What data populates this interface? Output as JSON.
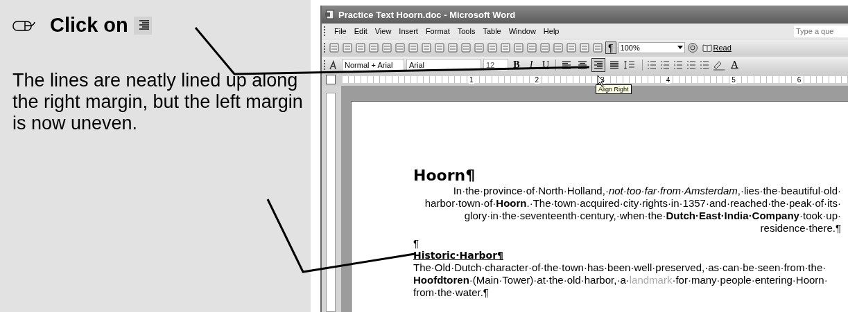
{
  "instructions": {
    "step": "Click on",
    "explanation": "The lines are neatly lined up along the right margin, but the left margin is now uneven."
  },
  "window": {
    "title": "Practice Text Hoorn.doc - Microsoft Word"
  },
  "menu": [
    "File",
    "Edit",
    "View",
    "Insert",
    "Format",
    "Tools",
    "Table",
    "Window",
    "Help"
  ],
  "help_search": {
    "placeholder": "Type a que"
  },
  "standard_toolbar": {
    "show_formatting": "¶",
    "zoom": "100%",
    "read": "Read"
  },
  "formatting_toolbar": {
    "style": "Normal + Arial",
    "font": "Arial",
    "size": "12",
    "font_styles": [
      "B",
      "I",
      "U"
    ],
    "alignment": [
      {
        "kind": "left",
        "selected": false
      },
      {
        "kind": "center",
        "selected": false
      },
      {
        "kind": "right",
        "selected": true
      },
      {
        "kind": "justify",
        "selected": false
      }
    ],
    "font_color": "A"
  },
  "tooltip": "Align Right",
  "ruler": [
    "1",
    "2",
    "3",
    "4",
    "5",
    "6"
  ],
  "document": {
    "heading": "Hoorn¶",
    "paragraph_1": [
      "In·the·province·of·North·Holland,·*not·too·far·from·Amsterdam*,·lies·the·beautiful·old·",
      "harbor·town·of·**Hoorn**.·The·town·acquired·city·rights·in·1357·and·reached·the·peak·of·its·",
      "glory·in·the·seventeenth·century,·when·the·**Dutch·East·India·Company**·took·up·",
      "residence·there.¶"
    ],
    "empty_paragraph": "¶",
    "subheading": "Historic·Harbor¶",
    "paragraph_2": [
      [
        {
          "kind": "text",
          "text": "The·Old·Dutch·character·of·the·town·has·been·well·preserved,·as·can·be·seen·from·the·"
        }
      ],
      [
        {
          "kind": "text",
          "text": "**Hoofdtoren**·(Main·Tower)·at·the·old·harbor,·a·"
        },
        {
          "kind": "faded",
          "text": "landmark"
        },
        {
          "kind": "text",
          "text": "·for·many·people·entering·Hoorn·"
        }
      ],
      [
        {
          "kind": "text",
          "text": "from·the·water.¶"
        }
      ]
    ]
  }
}
